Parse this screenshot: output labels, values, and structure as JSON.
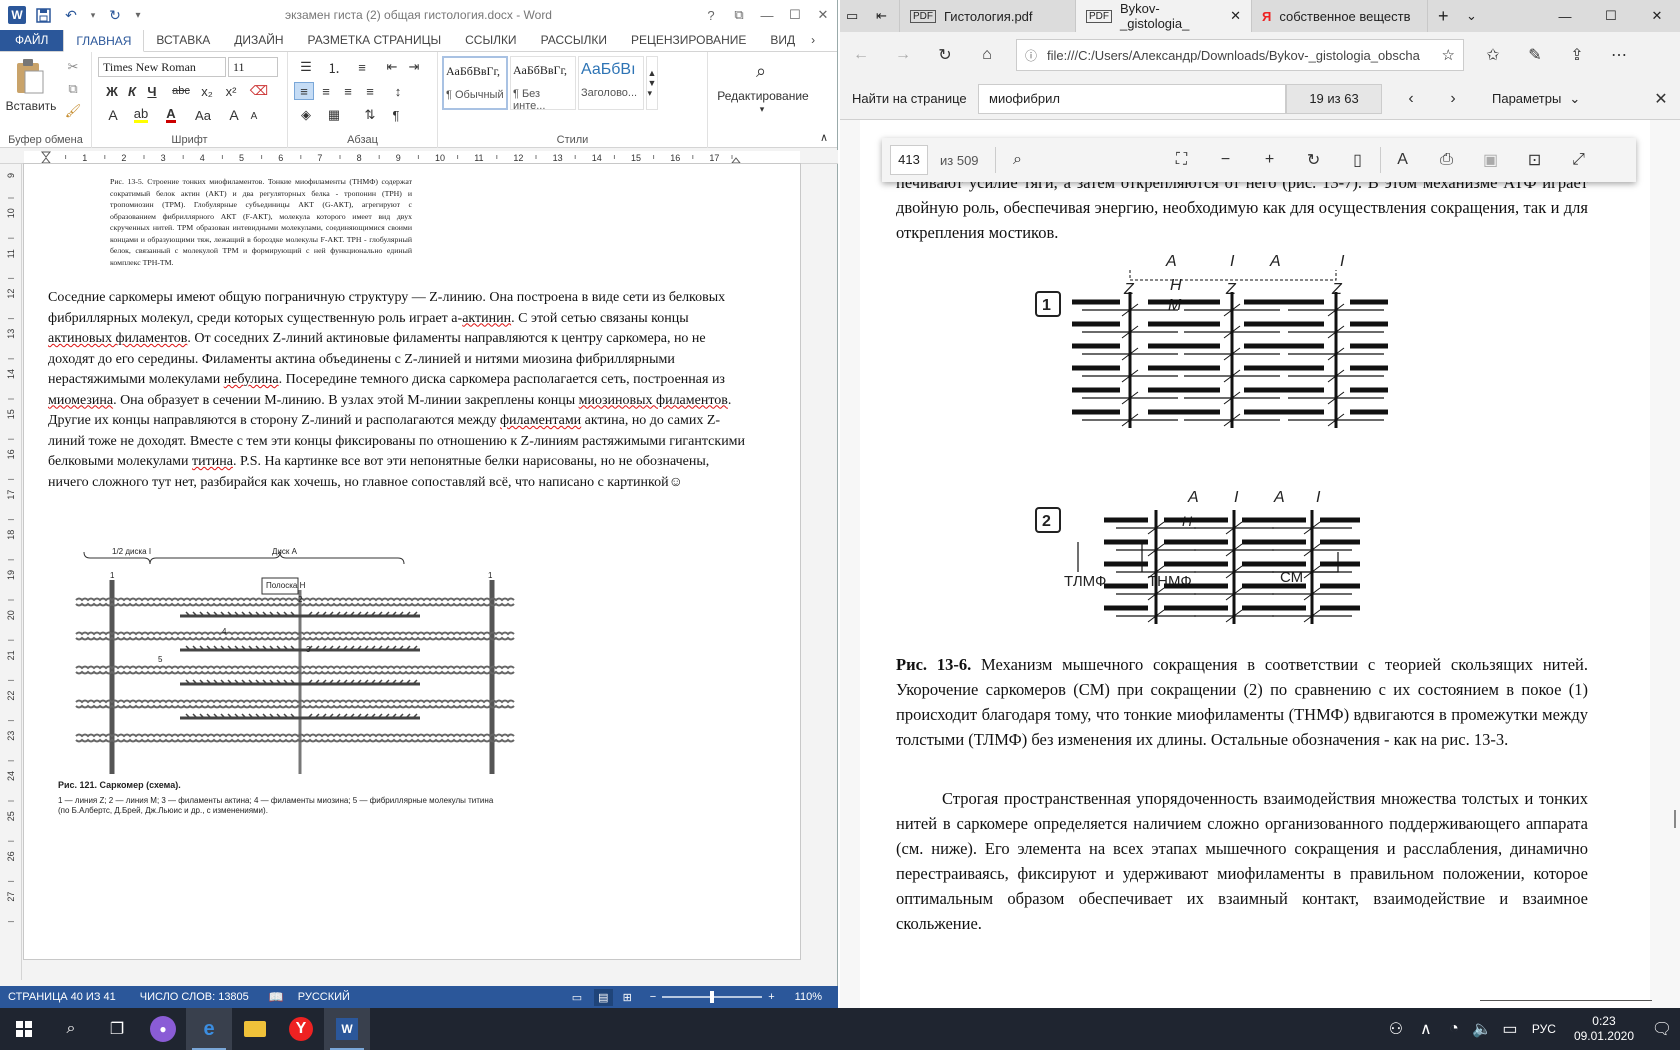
{
  "word": {
    "app_icon": "W",
    "doc_title": "экзамен гиста (2) общая гистология.docx - Word",
    "quick_access": [
      "save-icon",
      "undo-icon",
      "redo-icon",
      "customize-icon"
    ],
    "window_controls": [
      "?",
      "restore-ribbon",
      "minimize",
      "maximize",
      "close"
    ],
    "tabs": [
      "ФАЙЛ",
      "ГЛАВНАЯ",
      "ВСТАВКА",
      "ДИЗАЙН",
      "РАЗМЕТКА СТРАНИЦЫ",
      "ССЫЛКИ",
      "РАССЫЛКИ",
      "РЕЦЕНЗИРОВАНИЕ",
      "ВИД"
    ],
    "active_tab": "ГЛАВНАЯ",
    "ribbon": {
      "clipboard": {
        "label": "Буфер обмена",
        "paste": "Вставить"
      },
      "font": {
        "label": "Шрифт",
        "font_name": "Times New Roman",
        "font_size": "11",
        "bold": "Ж",
        "italic": "К",
        "underline": "Ч",
        "strike": "abc",
        "sub": "x₂",
        "sup": "x²",
        "grow": "A",
        "shrink": "A",
        "case": "Aa",
        "clear": "A"
      },
      "paragraph": {
        "label": "Абзац"
      },
      "styles": {
        "label": "Стили",
        "items": [
          {
            "preview": "АаБбВвГг,",
            "name": "¶ Обычный"
          },
          {
            "preview": "АаБбВвГг,",
            "name": "¶ Без инте..."
          },
          {
            "preview": "АаБбВı",
            "name": "Заголово..."
          }
        ]
      },
      "editing": {
        "label": "Редактирование"
      }
    },
    "ruler_numbers": [
      "1",
      "2",
      "3",
      "4",
      "5",
      "6",
      "7",
      "8",
      "9",
      "10",
      "11",
      "12",
      "13",
      "14",
      "15",
      "16",
      "17"
    ],
    "vruler_numbers": [
      "9",
      "10",
      "11",
      "12",
      "13",
      "14",
      "15",
      "16",
      "17",
      "18",
      "19",
      "20",
      "21",
      "22",
      "23",
      "24",
      "25",
      "26",
      "27"
    ],
    "caption_top": "Рис. 13-5. Строение тонких миофиламентов. Тонкие миофиламенты (ТНМФ) содержат сократимый белок актин (АКТ) и два регуляторных белка - тропонин (ТРН) и тропомиозин (ТРМ). Глобулярные субъединицы АКТ (G-АКТ), агрегируют с образованием фибриллярного АКТ (F-АКТ), молекула которого имеет вид двух скрученных нитей. ТРМ образован интевидными молекулами, соединяющимися своими концами и образующими тяж, лежащий в бороздке молекулы F-АКТ. ТРН - глобулярный белок, связанный с молекулой ТРМ и формирующий с ней функционально единый комплекс ТРН-ТМ.",
    "body_parts": [
      "Соседние саркомеры имеют общую пограничную структуру — Z-линию. Она построена в виде сети из белковых фибриллярных молекул, среди которых существенную роль играет а-",
      "актинин",
      ". С этой сетью связаны концы ",
      "актиновых филаментов",
      ". От соседних Z-линий актиновые филаменты направляются к центру саркомера, но не доходят до его середины. Филаменты актина объединены с Z-линией и нитями миозина фибриллярными нерастяжимыми молекулами ",
      "небулина",
      ". Посередине темного диска саркомера располагается сеть, построенная из ",
      "миомезина",
      ". Она образует в сечении М-линию. В узлах этой М-линии закреплены концы ",
      "миозиновых филаментов",
      ". Другие их концы направляются в сторону Z-линий и располагаются между ",
      "филаментами",
      " актина, но до самих Z-линий тоже не доходят. Вместе с тем эти концы фиксированы по отношению к Z-линиям растяжимыми гигантскими белковыми молекулами ",
      "титина",
      ". P.S. На картинке все вот эти непонятные белки нарисованы, но не обозначены, ничего сложного тут нет, разбирайся как хочешь, но главное сопоставляй всё, что написано с картинкой☺"
    ],
    "figure": {
      "label_half_disk": "1/2 диска I",
      "label_disk_a": "Диск А",
      "label_band_h": "Полоска Н",
      "num_labels": [
        "1",
        "2",
        "3",
        "4",
        "5",
        "1"
      ],
      "caption_title": "Рис. 121.  Саркомер (схема).",
      "caption_body": "1 — линия Z; 2 — линия M; 3 — филаменты актина; 4 — филаменты миозина; 5 — фибриллярные молекулы титина (по Б.Албертс, Д.Брей, Дж.Льюис и др., с изменениями)."
    },
    "status": {
      "page": "СТРАНИЦА 40 ИЗ 41",
      "words": "ЧИСЛО СЛОВ: 13805",
      "language": "РУССКИЙ",
      "zoom": "110%",
      "zoom_minus": "−",
      "zoom_plus": "+"
    }
  },
  "edge": {
    "tabs": [
      {
        "title": "Гистология.pdf",
        "icon": "pdf-icon"
      },
      {
        "title": "Bykov-_gistologia_",
        "icon": "pdf-icon",
        "active": true
      },
      {
        "title": "собственное веществ",
        "icon": "yandex-icon"
      }
    ],
    "new_tab": "+",
    "url": "file:///C:/Users/Александр/Downloads/Bykov-_gistologia_obscha",
    "find": {
      "label": "Найти на странице",
      "query": "миофибрил",
      "count": "19 из 63",
      "options": "Параметры"
    },
    "pdf_toolbar": {
      "page": "413",
      "of": "из 509"
    },
    "text_top": "печивают усилие тяги, а затем открепляются от него (рис. 13-7). В этом механизме АТФ играет двойную роль, обеспечивая энергию, необходимую как для осуществления сокращения, так и для открепления мостиков.",
    "figure": {
      "panel1": "1",
      "panel2": "2",
      "labels1": [
        "A",
        "I",
        "A",
        "I",
        "Z",
        "Z",
        "Z",
        "H",
        "M"
      ],
      "labels2": [
        "A",
        "I",
        "A",
        "I",
        "H"
      ],
      "tlmf": "ТЛМФ",
      "tnmf": "ТНМФ",
      "cm": "СМ"
    },
    "caption_bold": "Рис. 13-6.",
    "caption": " Механизм мышечного сокращения в соответствии с теорией скользящих нитей. Укорочение саркомеров (СМ) при сокращении (2) по сравнению с их состоянием в покое (1) происходит благодаря тому, что тонкие миофиламенты (ТНМФ) вдвигаются в промежутки между толстыми (ТЛМФ) без изменения их длины. Остальные обозначения - как на рис. 13-3.",
    "para2": "Строгая пространственная упорядоченность взаимодействия множества толстых и тонких нитей в саркомере определяется наличием сложно организованного поддерживающего аппарата (см. ниже). Его элемента на всех этапах мышечного сокращения и расслабления, динамично перестраиваясь, фиксируют и удерживают миофиламенты в правильном положении, которое оптимальным образом обеспечивает их взаимный контакт, взаимодействие и взаимное скольжение."
  },
  "taskbar": {
    "time": "0:23",
    "date": "09.01.2020",
    "lang": "РУС",
    "apps": [
      "start-icon",
      "search-icon",
      "task-view-icon",
      "cortana-mic-icon",
      "edge-icon",
      "explorer-icon",
      "yandex-browser-icon",
      "word-icon"
    ]
  },
  "colors": {
    "word_blue": "#2b579a",
    "edge_tab_bg": "#dcdcdc",
    "taskbar": "#1f2530",
    "spell_red": "#d11111"
  }
}
